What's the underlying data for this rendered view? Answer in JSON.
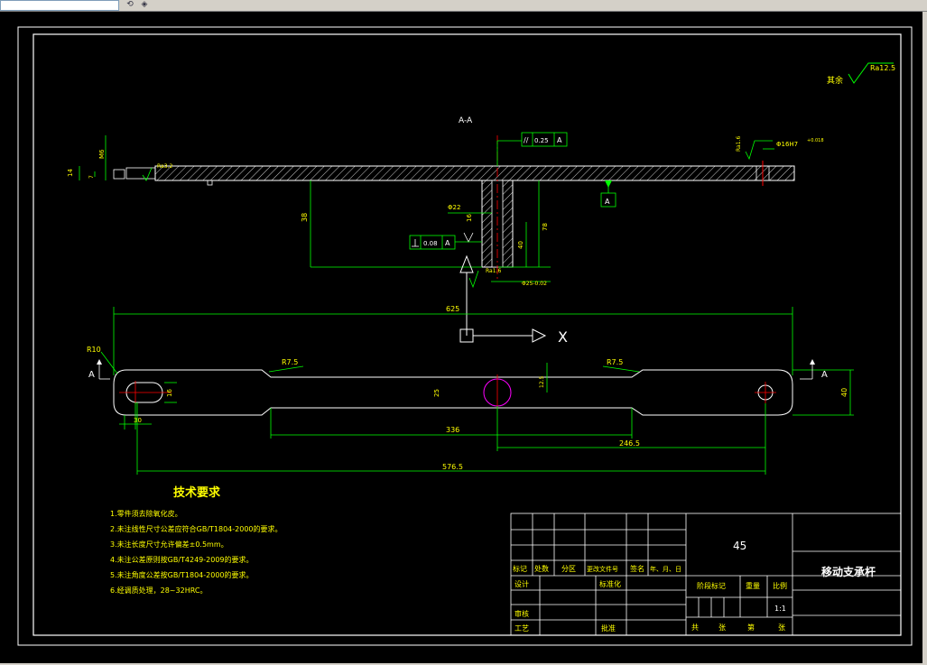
{
  "toolbar": {
    "field_value": "",
    "icon_a": "⟲",
    "icon_b": "◈"
  },
  "drawing": {
    "section_title": "A-A",
    "roughness_rest_label": "其余",
    "roughness_rest_value": "Ra12.5",
    "tol_parallel_value": "0.25",
    "tol_parallel_datum": "A",
    "tol_perp_value": "0.08",
    "tol_perp_datum": "A",
    "datum_label": "A",
    "hole_fit": "Φ16H7",
    "hole_fit_dev": "+0.018",
    "rough_16": "Ra1.6",
    "rough_32": "Ra3.2",
    "dim_14": "14",
    "dim_7": "7",
    "dim_m6": "M6",
    "dim_38": "38",
    "dim_phi22": "Φ22",
    "dim_16v": "16",
    "dim_40v": "40",
    "dim_78": "78",
    "dim_phi25": "Φ25-0.02",
    "dim_625": "625",
    "dim_r10": "R10",
    "dim_r75_l": "R7.5",
    "dim_r75_r": "R7.5",
    "dim_16_slot": "16",
    "dim_25": "25",
    "dim_r125": "12.5",
    "dim_40_right": "40",
    "dim_30": "30",
    "dim_336": "336",
    "dim_2465": "246.5",
    "dim_5765": "576.5",
    "section_mark_left": "A",
    "section_mark_right": "A",
    "axis_x": "X"
  },
  "tech": {
    "title": "技术要求",
    "items": [
      "1.零件须去除氧化皮。",
      "2.未注线性尺寸公差应符合GB/T1804-2000的要求。",
      "3.未注长度尺寸允许偏差±0.5mm。",
      "4.未注公差原则按GB/T4249-2009的要求。",
      "5.未注角度公差按GB/T1804-2000的要求。",
      "6.经调质处理，28~32HRC。"
    ]
  },
  "title_block": {
    "material": "45",
    "part_name": "移动支承杆",
    "h_mark": "标记",
    "h_count": "处数",
    "h_zone": "分区",
    "h_docno": "更改文件号",
    "h_sign": "签名",
    "h_date": "年、月、日",
    "design": "设计",
    "standard": "标准化",
    "stage_mark": "阶段标记",
    "weight": "重量",
    "scale_label": "比例",
    "scale_value": "1:1",
    "review": "审核",
    "process": "工艺",
    "approve": "批准",
    "total": "共",
    "sheets": "张",
    "no": "第",
    "sheet": "张"
  }
}
